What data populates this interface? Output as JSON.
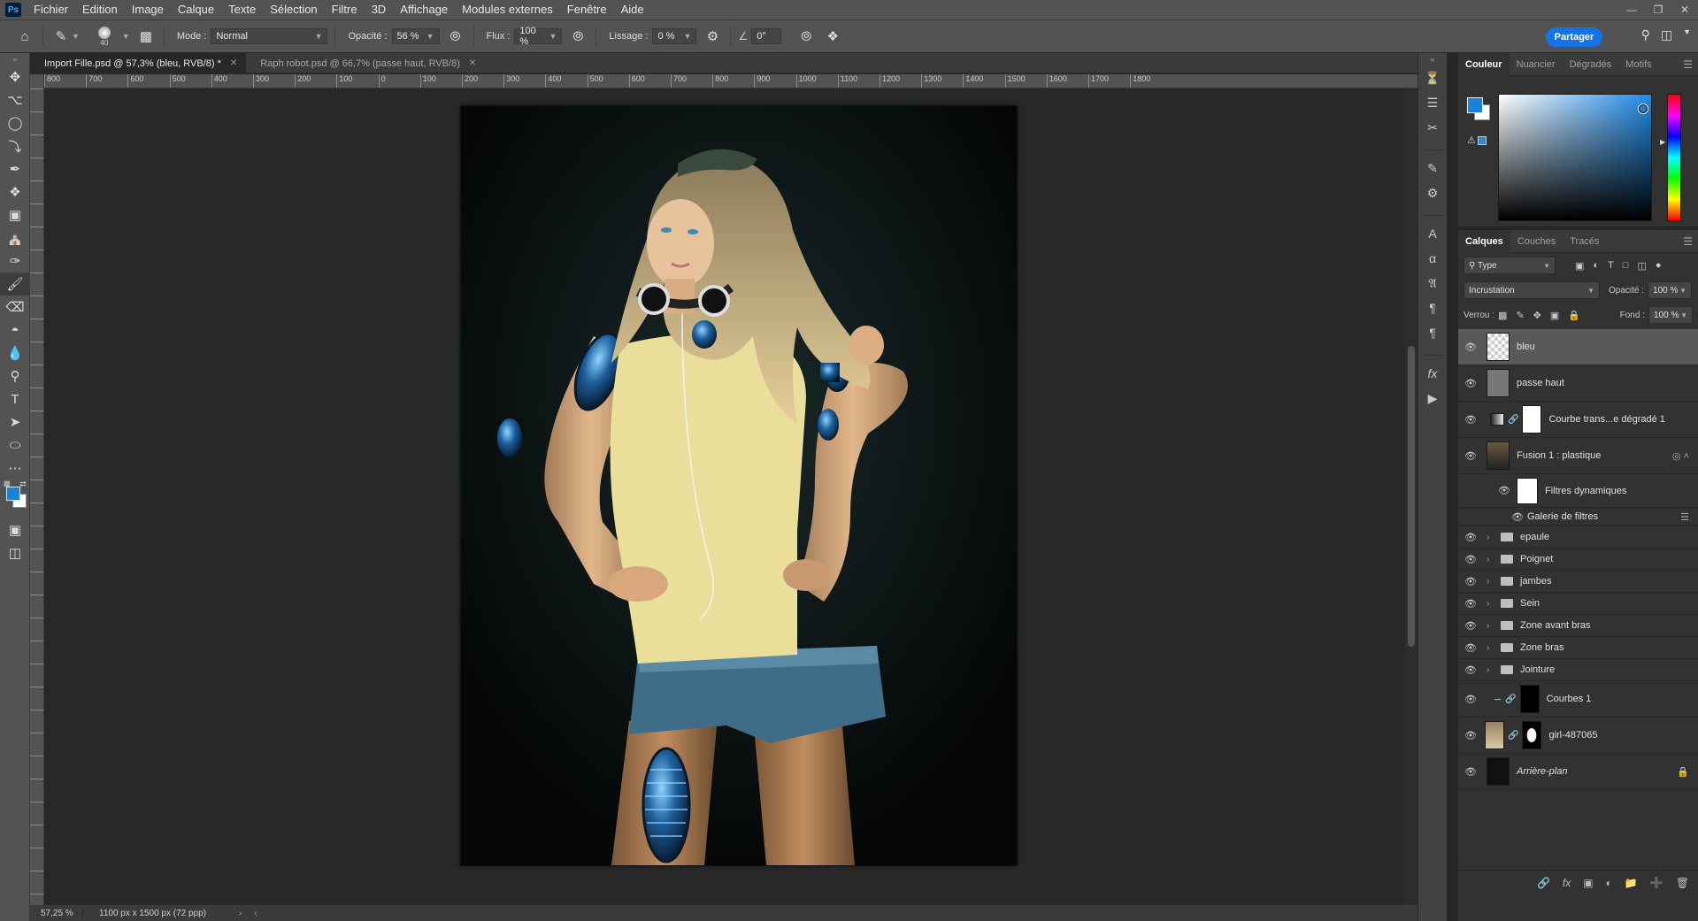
{
  "menubar": {
    "app_logo": "Ps",
    "items": [
      "Fichier",
      "Edition",
      "Image",
      "Calque",
      "Texte",
      "Sélection",
      "Filtre",
      "3D",
      "Affichage",
      "Modules externes",
      "Fenêtre",
      "Aide"
    ]
  },
  "options": {
    "brush_size": "40",
    "mode_label": "Mode :",
    "mode_value": "Normal",
    "opacity_label": "Opacité :",
    "opacity_value": "56 %",
    "flow_label": "Flux :",
    "flow_value": "100 %",
    "smoothing_label": "Lissage :",
    "smoothing_value": "0 %",
    "angle_value": "0°",
    "share_label": "Partager"
  },
  "tabs": [
    {
      "label": "Import Fille.psd @ 57,3% (bleu, RVB/8) *",
      "active": true
    },
    {
      "label": "Raph robot.psd @ 66,7% (passe haut, RVB/8)",
      "active": false
    }
  ],
  "ruler": {
    "labels": [
      "800",
      "700",
      "600",
      "500",
      "400",
      "300",
      "200",
      "100",
      "0",
      "100",
      "200",
      "300",
      "400",
      "500",
      "600",
      "700",
      "800",
      "900",
      "1000",
      "1100",
      "1200",
      "1300",
      "1400",
      "1500",
      "1600",
      "1700",
      "1800"
    ]
  },
  "status": {
    "zoom": "57,25 %",
    "doc_info": "1100 px x 1500 px (72 ppp)"
  },
  "color_panel": {
    "tabs": [
      "Couleur",
      "Nuancier",
      "Dégradés",
      "Motifs"
    ],
    "fg_color": "#1b82d9",
    "bg_color": "#ffffff"
  },
  "layers_panel": {
    "tabs": [
      "Calques",
      "Couches",
      "Tracés"
    ],
    "filter_value": "Type",
    "blend_mode": "Incrustation",
    "opacity_label": "Opacité :",
    "opacity_value": "100 %",
    "lock_label": "Verrou :",
    "fill_label": "Fond :",
    "fill_value": "100 %",
    "layers": [
      {
        "name": "bleu",
        "type": "pixel",
        "selected": true
      },
      {
        "name": "passe haut",
        "type": "pixel"
      },
      {
        "name": "Courbe trans...e dégradé 1",
        "type": "adjustment"
      },
      {
        "name": "Fusion 1 : plastique",
        "type": "smart"
      },
      {
        "name": "Filtres dynamiques",
        "type": "sub"
      },
      {
        "name": "Galerie de filtres",
        "type": "sub2"
      },
      {
        "name": "epaule",
        "type": "group"
      },
      {
        "name": "Poignet",
        "type": "group"
      },
      {
        "name": "jambes",
        "type": "group"
      },
      {
        "name": "Sein",
        "type": "group"
      },
      {
        "name": "Zone avant bras",
        "type": "group"
      },
      {
        "name": "Zone bras",
        "type": "group"
      },
      {
        "name": "Jointure",
        "type": "group"
      },
      {
        "name": "Courbes 1",
        "type": "curves"
      },
      {
        "name": "girl-487065",
        "type": "photo"
      },
      {
        "name": "Arrière-plan",
        "type": "background"
      }
    ]
  }
}
